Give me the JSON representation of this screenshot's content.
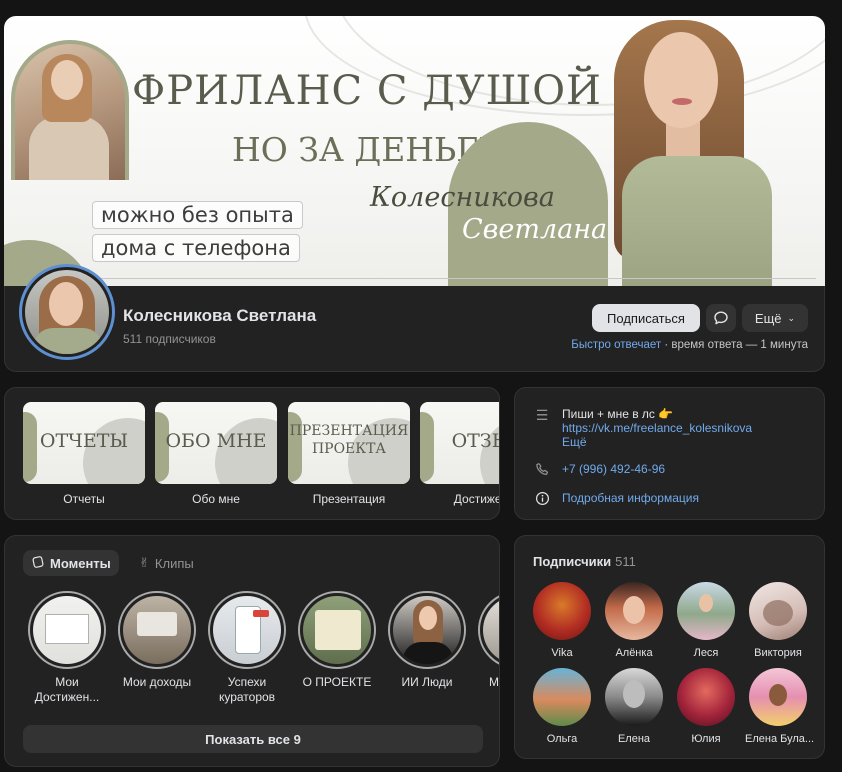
{
  "cover": {
    "title": "ФРИЛАНС С ДУШОЙ",
    "subtitle": "НО ЗА ДЕНЬГИ",
    "tag1": "можно без опыта",
    "tag2": "дома с телефона",
    "sign1": "Колесникова",
    "sign2": "Светлана"
  },
  "profile": {
    "name": "Колесникова Светлана",
    "subscribers": "511 подписчиков",
    "subscribe_label": "Подписаться",
    "more_label": "Ещё",
    "reply_fast": "Быстро отвечает",
    "reply_rest": " · время ответа — 1 минута"
  },
  "highlights": [
    {
      "thumb": "ОТЧЕТЫ",
      "label": "Отчеты"
    },
    {
      "thumb": "ОБО МНЕ",
      "label": "Обо мне"
    },
    {
      "thumb": "ПРЕЗЕНТАЦИЯ ПРОЕКТА",
      "label": "Презентация"
    },
    {
      "thumb": "ОТЗЫ",
      "label": "Достижен"
    }
  ],
  "info": {
    "status": "Пиши + мне в лс 👉",
    "link": "https://vk.me/freelance_kolesnikova",
    "more": "Ещё",
    "phone": "+7 (996) 492-46-96",
    "details": "Подробная информация"
  },
  "moments": {
    "tab_moments": "Моменты",
    "tab_clips": "Клипы",
    "items": [
      {
        "label": "Мои Достижен..."
      },
      {
        "label": "Мои доходы"
      },
      {
        "label": "Успехи кураторов"
      },
      {
        "label": "О ПРОЕКТЕ"
      },
      {
        "label": "ИИ Люди"
      },
      {
        "label": "Ма"
      }
    ],
    "show_all": "Показать все 9"
  },
  "subscribers": {
    "title": "Подписчики",
    "count": "511",
    "people": [
      {
        "name": "Vika"
      },
      {
        "name": "Алёнка"
      },
      {
        "name": "Леся"
      },
      {
        "name": "Виктория"
      },
      {
        "name": "Ольга"
      },
      {
        "name": "Елена"
      },
      {
        "name": "Юлия"
      },
      {
        "name": "Елена Була..."
      }
    ]
  },
  "colors": {
    "accent_link": "#71aaeb",
    "avatar_ring": "#5e8fd1",
    "brand_sage": "#a4a98a",
    "card_bg": "#222222",
    "page_bg": "#141414"
  }
}
